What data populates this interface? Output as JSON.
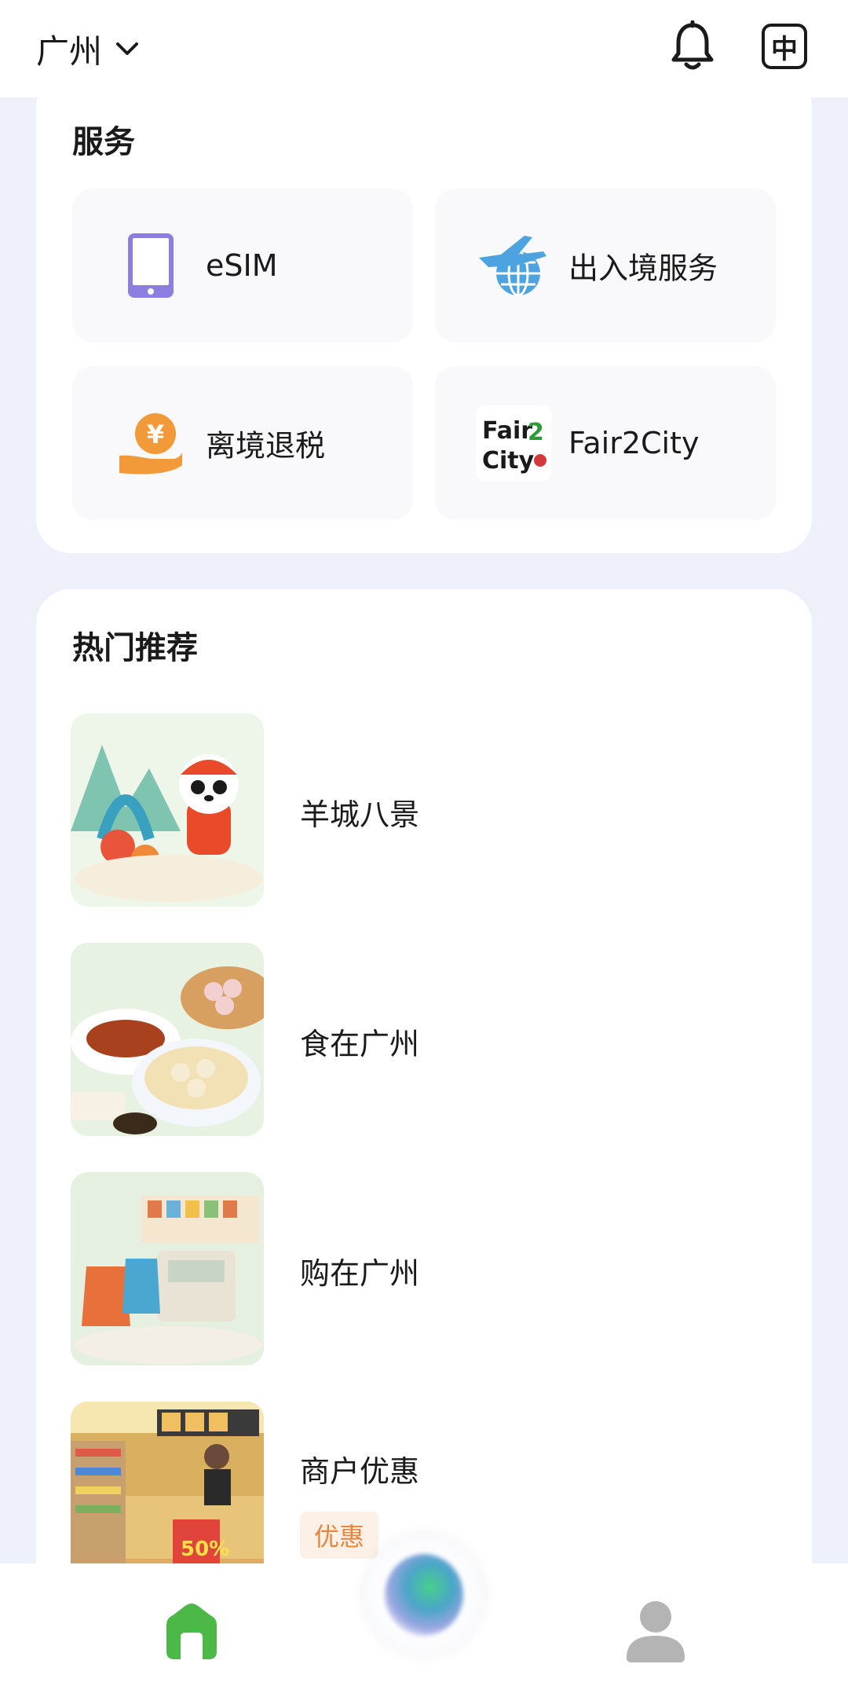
{
  "header": {
    "city": "广州",
    "lang_label": "中"
  },
  "services": {
    "title": "服务",
    "items": [
      {
        "label": "eSIM",
        "icon": "phone-icon"
      },
      {
        "label": "出入境服务",
        "icon": "plane-globe-icon"
      },
      {
        "label": "离境退税",
        "icon": "yen-hand-icon"
      },
      {
        "label": "Fair2City",
        "icon": "fair2city-logo"
      }
    ]
  },
  "hot": {
    "title": "热门推荐",
    "items": [
      {
        "label": "羊城八景"
      },
      {
        "label": "食在广州"
      },
      {
        "label": "购在广州"
      },
      {
        "label": "商户优惠",
        "badge": "优惠"
      }
    ]
  },
  "colors": {
    "accent_green": "#4cb848",
    "esim_purple": "#8c7ee0",
    "plane_blue": "#4da3e0",
    "tax_orange": "#f29a3a",
    "badge_orange": "#e8873b"
  }
}
